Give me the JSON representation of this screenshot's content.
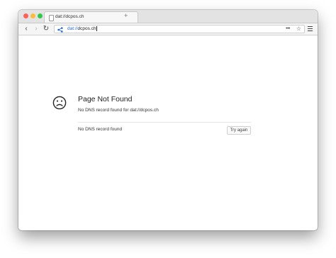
{
  "colors": {
    "close": "#fc605b",
    "minimize": "#fdbc40",
    "zoom": "#34c84a",
    "url_scheme": "#2a6bd0"
  },
  "tabs": [
    {
      "title": "dat://dcpos.ch",
      "icon": "file-icon"
    }
  ],
  "new_tab_label": "+",
  "nav": {
    "back_glyph": "‹",
    "forward_glyph": "›",
    "reload_glyph": "↻"
  },
  "url": {
    "scheme": "dat://",
    "host": "dcpos.ch",
    "site_icon": "share-icon",
    "more_glyph": "•••",
    "star_glyph": "☆"
  },
  "error": {
    "icon": "sad-face-icon",
    "title": "Page Not Found",
    "description": "No DNS record found for dat://dcpos.ch",
    "detail": "No DNS record found",
    "retry_label": "Try again"
  }
}
